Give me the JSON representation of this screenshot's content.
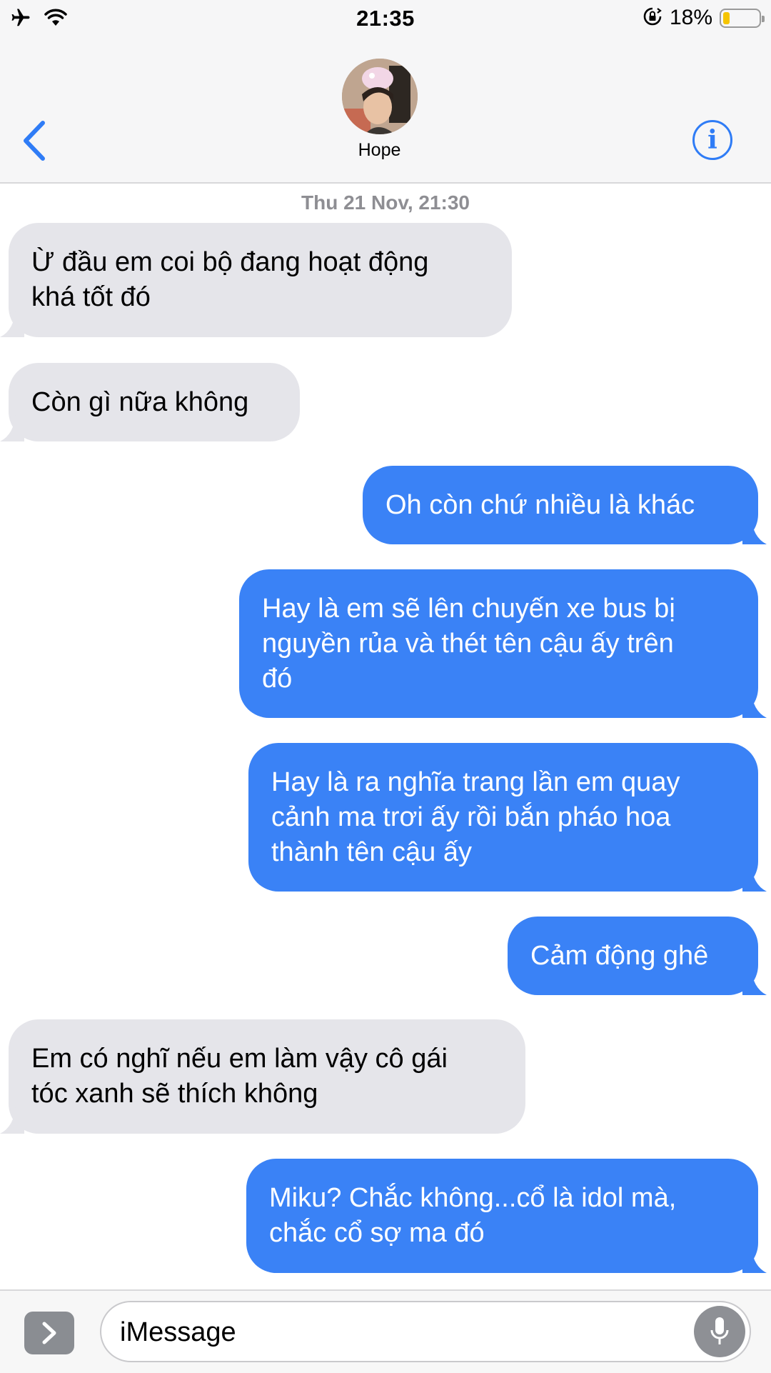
{
  "status_bar": {
    "time": "21:35",
    "battery_percent": "18%",
    "battery_level": 0.18,
    "icons": [
      "airplane-icon",
      "wifi-icon",
      "rotation-lock-icon",
      "battery-icon"
    ]
  },
  "header": {
    "contact_name": "Hope",
    "back_icon": "chevron-left-icon",
    "info_icon": "info-icon"
  },
  "conversation": {
    "timestamp": "Thu 21 Nov, 21:30",
    "messages": [
      {
        "direction": "incoming",
        "lines": [
          "Ừ đầu em coi bộ đang hoạt động",
          "khá tốt đó"
        ]
      },
      {
        "direction": "incoming",
        "lines": [
          "Còn gì nữa không"
        ]
      },
      {
        "direction": "outgoing",
        "lines": [
          "Oh còn chứ nhiều là khác"
        ]
      },
      {
        "direction": "outgoing",
        "lines": [
          "Hay là em sẽ lên chuyến xe bus bị",
          "nguyền rủa và thét tên cậu ấy trên",
          "đó"
        ]
      },
      {
        "direction": "outgoing",
        "lines": [
          "Hay là ra nghĩa trang lần em quay",
          "cảnh ma trơi ấy rồi bắn pháo hoa",
          "thành tên cậu ấy"
        ]
      },
      {
        "direction": "outgoing",
        "lines": [
          "Cảm động ghê"
        ]
      },
      {
        "direction": "incoming",
        "lines": [
          "Em có nghĩ nếu em làm vậy cô gái",
          "tóc xanh sẽ thích không"
        ]
      },
      {
        "direction": "outgoing",
        "lines": [
          "Miku? Chắc không...cổ là idol mà,",
          "chắc cổ sợ ma đó"
        ]
      }
    ]
  },
  "input_bar": {
    "placeholder": "iMessage",
    "value": "",
    "apps_icon": "chevron-right-icon",
    "mic_icon": "microphone-icon"
  },
  "colors": {
    "outgoing_bubble": "#3a82f6",
    "incoming_bubble": "#e5e5ea",
    "accent": "#2f7cf6",
    "header_bg": "#f6f6f7"
  }
}
